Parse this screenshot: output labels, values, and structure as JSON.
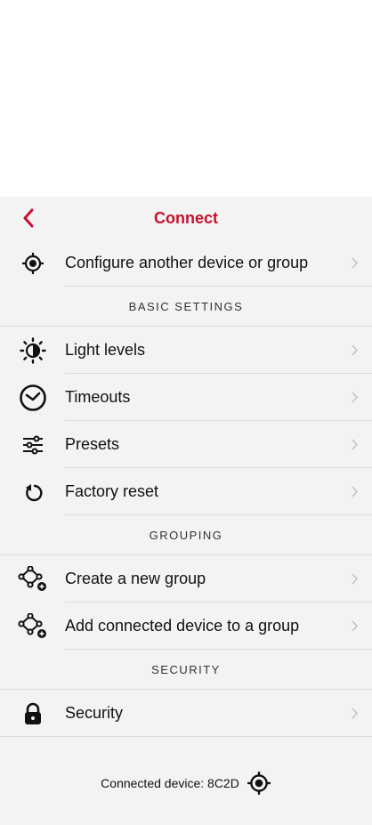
{
  "nav": {
    "title": "Connect",
    "back_icon": "chevron-left-icon",
    "accent": "#c8102e"
  },
  "rows_top": [
    {
      "label": "Configure another device or group",
      "icon": "target-icon"
    }
  ],
  "sections": {
    "basic": "BASIC SETTINGS",
    "grouping": "GROUPING",
    "security": "SECURITY"
  },
  "basic_items": [
    {
      "label": "Light levels",
      "icon": "brightness-icon"
    },
    {
      "label": "Timeouts",
      "icon": "clock-icon"
    },
    {
      "label": "Presets",
      "icon": "sliders-icon"
    },
    {
      "label": "Factory reset",
      "icon": "reset-icon"
    }
  ],
  "grouping_items": [
    {
      "label": "Create a new group",
      "icon": "group-add-icon"
    },
    {
      "label": "Add connected device to a group",
      "icon": "group-add-icon"
    }
  ],
  "security_items": [
    {
      "label": "Security",
      "icon": "lock-icon"
    }
  ],
  "footer": {
    "text": "Connected device: 8C2D",
    "icon": "target-icon"
  }
}
